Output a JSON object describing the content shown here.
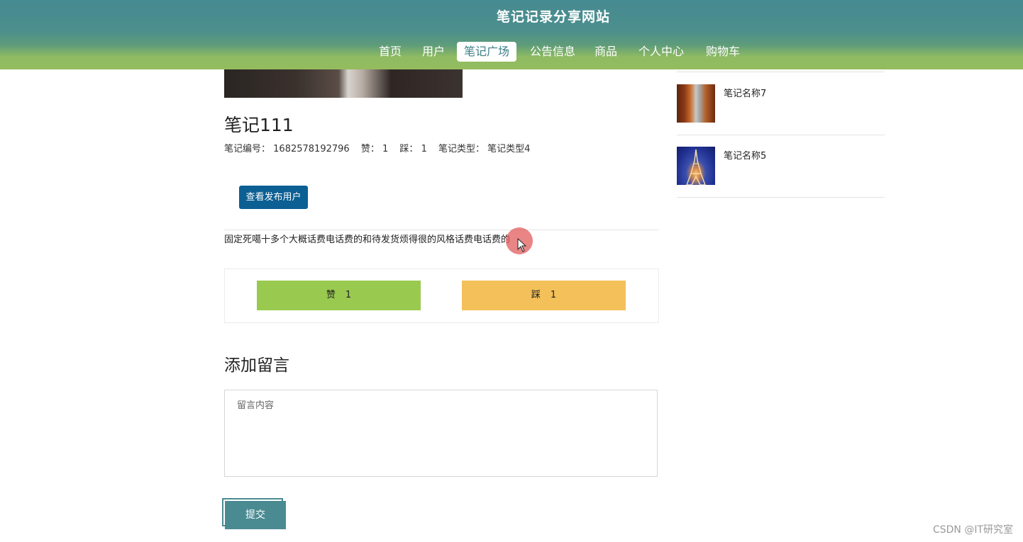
{
  "header": {
    "site_title": "笔记记录分享网站",
    "nav": [
      {
        "label": "首页",
        "active": false
      },
      {
        "label": "用户",
        "active": false
      },
      {
        "label": "笔记广场",
        "active": true
      },
      {
        "label": "公告信息",
        "active": false
      },
      {
        "label": "商品",
        "active": false
      },
      {
        "label": "个人中心",
        "active": false
      },
      {
        "label": "购物车",
        "active": false
      }
    ]
  },
  "note": {
    "title": "笔记111",
    "meta": {
      "id_label": "笔记编号：",
      "id_value": "1682578192796",
      "like_label": "赞：",
      "like_value": "1",
      "dislike_label": "踩：",
      "dislike_value": "1",
      "type_label": "笔记类型：",
      "type_value": "笔记类型4"
    },
    "view_user_button": "查看发布用户",
    "content": "固定死噶十多个大概话费电话费的和待发货烦得很的风格话费电话费的"
  },
  "votes": {
    "like_label": "赞",
    "like_count": "1",
    "dislike_label": "踩",
    "dislike_count": "1",
    "like_color": "#99ca4f",
    "dislike_color": "#f3c05a"
  },
  "comment": {
    "heading": "添加留言",
    "placeholder": "留言内容",
    "value": "",
    "submit_label": "提交"
  },
  "sidebar": {
    "items": [
      {
        "label": "笔记名称7",
        "icon": "corridor-thumbnail"
      },
      {
        "label": "笔记名称5",
        "icon": "eiffel-tower-thumbnail"
      }
    ]
  },
  "watermark": "CSDN @IT研究室",
  "colors": {
    "header_top": "#468a92",
    "header_bottom": "#94bc5e",
    "primary_button": "#0b5f93",
    "submit_button": "#4a8b92"
  }
}
